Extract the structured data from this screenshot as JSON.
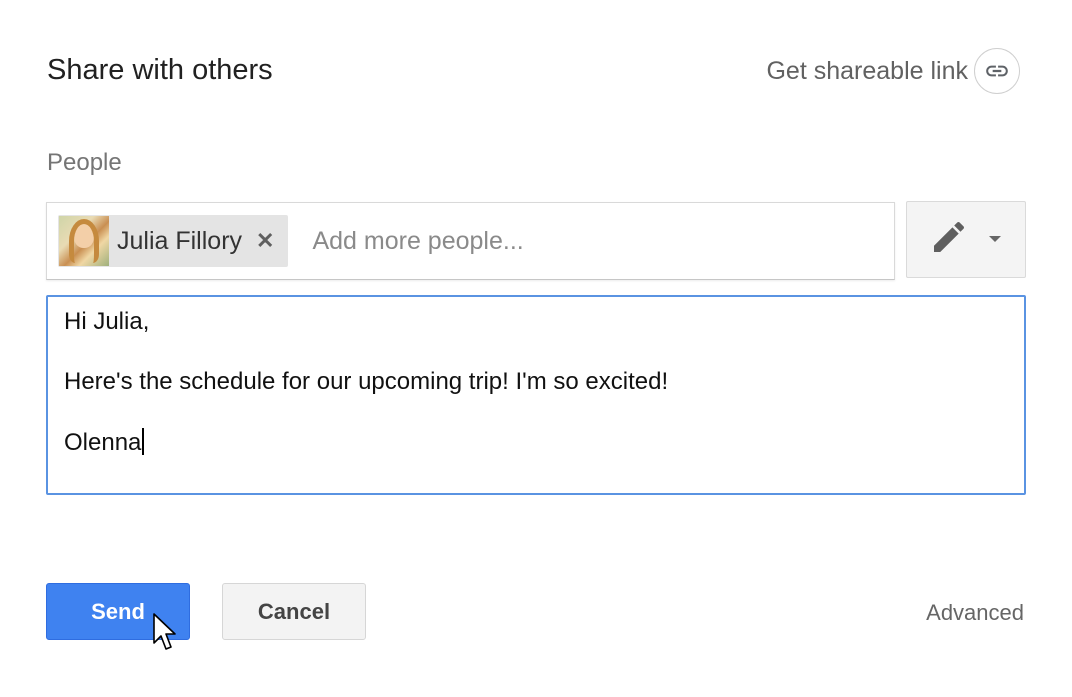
{
  "dialog": {
    "title": "Share with others",
    "shareable_link_label": "Get shareable link",
    "link_icon": "link-icon"
  },
  "people": {
    "label": "People",
    "chips": [
      {
        "name": "Julia Fillory",
        "remove_icon": "close-icon",
        "avatar": "avatar-photo"
      }
    ],
    "input_placeholder": "Add more people...",
    "input_value": "",
    "permission_icon": "pencil-icon",
    "dropdown_icon": "chevron-down-icon"
  },
  "message": {
    "lines": [
      "Hi Julia,",
      "Here's the schedule for our upcoming trip! I'm so excited!",
      "Olenna"
    ]
  },
  "actions": {
    "send_label": "Send",
    "cancel_label": "Cancel",
    "advanced_label": "Advanced"
  },
  "colors": {
    "accent": "#3f82f0",
    "focus_border": "#5a93e2"
  }
}
